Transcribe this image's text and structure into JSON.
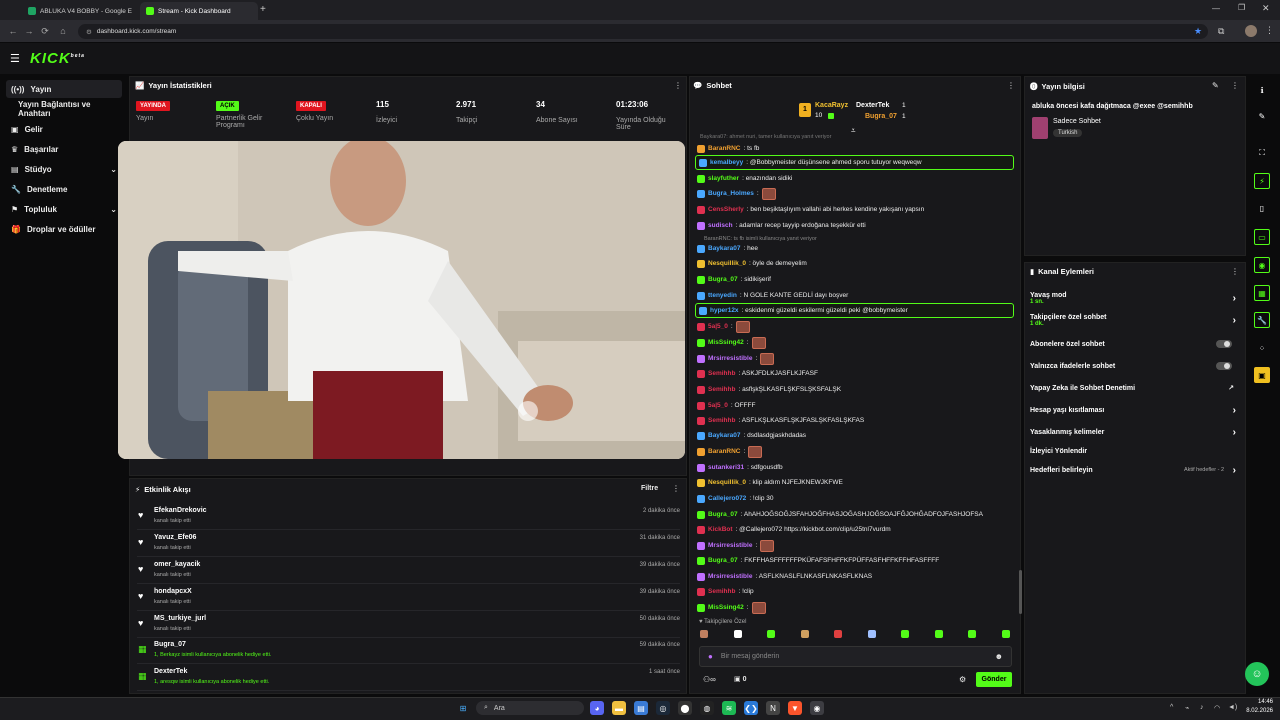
{
  "browser": {
    "tabs": [
      {
        "title": "ABLUKA V4 BOBBY - Google E"
      },
      {
        "title": "Stream - Kick Dashboard"
      }
    ],
    "url": "dashboard.kick.com/stream"
  },
  "app": {
    "logo": "KICK",
    "logo_sup": "beta"
  },
  "sidebar": {
    "items": [
      {
        "label": "Yayın"
      },
      {
        "label": "Yayın Bağlantısı ve Anahtarı"
      },
      {
        "label": "Gelir"
      },
      {
        "label": "Başarılar"
      },
      {
        "label": "Stüdyo"
      },
      {
        "label": "Denetleme"
      },
      {
        "label": "Topluluk"
      },
      {
        "label": "Droplar ve ödüller"
      }
    ]
  },
  "stats": {
    "title": "Yayın İstatistikleri",
    "items": [
      {
        "value": "YAYINDA",
        "label": "Yayın"
      },
      {
        "value": "AÇIK",
        "label": "Partnerlik Gelir Programı"
      },
      {
        "value": "KAPALI",
        "label": "Çoklu Yayın"
      },
      {
        "value": "115",
        "label": "İzleyici"
      },
      {
        "value": "2.971",
        "label": "Takipçi"
      },
      {
        "value": "34",
        "label": "Abone Sayısı"
      },
      {
        "value": "01:23:06",
        "label": "Yayında Olduğu Süre"
      }
    ]
  },
  "activity": {
    "title": "Etkinlik Akışı",
    "filter": "Filtre",
    "items": [
      {
        "name": "EfekanDrekovic",
        "desc": "kanalı takip etti",
        "time": "2 dakika önce",
        "type": "follow"
      },
      {
        "name": "Yavuz_Efe06",
        "desc": "kanalı takip etti",
        "time": "31 dakika önce",
        "type": "follow"
      },
      {
        "name": "omer_kayacik",
        "desc": "kanalı takip etti",
        "time": "39 dakika önce",
        "type": "follow"
      },
      {
        "name": "hondapcxX",
        "desc": "kanalı takip etti",
        "time": "39 dakika önce",
        "type": "follow"
      },
      {
        "name": "MS_turkiye_jurl",
        "desc": "kanalı takip etti",
        "time": "50 dakika önce",
        "type": "follow"
      },
      {
        "name": "Bugra_07",
        "desc": "1, Berkayz isimli kullanıcıya abonelik hediye etti.",
        "time": "59 dakika önce",
        "type": "gift"
      },
      {
        "name": "DexterTek",
        "desc": "1, aresqw isimli kullanıcıya abonelik hediye etti.",
        "time": "1 saat önce",
        "type": "gift"
      }
    ]
  },
  "chat": {
    "title": "Sohbet",
    "leaderboard": [
      {
        "name": "KacaRayz",
        "count": "10"
      },
      {
        "name": "DexterTek",
        "count": "1"
      },
      {
        "name": "Bugra_07",
        "count": "1"
      }
    ],
    "reply_note_top": "Baykara07: ahmet nuri, tamer kullanıcıya yanıt veriyor",
    "messages": [
      {
        "user": "BaranRNC",
        "text": ": ts fb",
        "color": "#f0a030",
        "hl": false
      },
      {
        "user": "kemalbeyy",
        "text": ": @Bobbymeister düşünsene ahmed sporu tutuyor weqweqw",
        "color": "#4aa8ff",
        "hl": true
      },
      {
        "user": "slayfuther",
        "text": ": enazından sidiki",
        "color": "#53fc18",
        "hl": false
      },
      {
        "user": "Bugra_Holmes",
        "text": ":",
        "color": "#4aa8ff",
        "hl": false
      },
      {
        "user": "CensSherly",
        "text": ": ben beşiktaşlıyım vallahi abi herkes kendine yakışanı yapsın",
        "color": "#e03050",
        "hl": false
      },
      {
        "user": "sudisch",
        "text": ": adamlar recep tayyip erdoğana teşekkür etti",
        "color": "#c070ff",
        "hl": false
      },
      {
        "user": "Baykara07",
        "text": ": hee",
        "color": "#4aa8ff",
        "hl": false
      },
      {
        "user": "Nesquillik_0",
        "text": ": öyle de demeyelim",
        "color": "#f0c030",
        "hl": false
      },
      {
        "user": "Bugra_07",
        "text": ": sidikişerif",
        "color": "#53fc18",
        "hl": false
      },
      {
        "user": "ttenyedin",
        "text": ": N GOLE KANTE GEDLİ dayı boşver",
        "color": "#4aa8ff",
        "hl": false
      },
      {
        "user": "hyper12x",
        "text": ": eskidenmi güzeldi eskilermi güzeldi peki @bobbymeister",
        "color": "#4aa8ff",
        "hl": true
      },
      {
        "user": "5a|5_0",
        "text": ":",
        "color": "#e03050",
        "hl": false
      },
      {
        "user": "MisSsing42",
        "text": ":",
        "color": "#53fc18",
        "hl": false
      },
      {
        "user": "Mrsirresistible",
        "text": ":",
        "color": "#c070ff",
        "hl": false
      },
      {
        "user": "Semihhb",
        "text": ": ASKJFDLKJASFLKJFASF",
        "color": "#e03050",
        "hl": false
      },
      {
        "user": "Semihhb",
        "text": ": asflşkŞLKASFLŞKFSLŞKSFALŞK",
        "color": "#e03050",
        "hl": false
      },
      {
        "user": "5a|5_0",
        "text": ": OFFFF",
        "color": "#e03050",
        "hl": false
      },
      {
        "user": "Semihhb",
        "text": ": ASFLKŞLKASFLŞKJFASLŞKFASLŞKFAS",
        "color": "#e03050",
        "hl": false
      },
      {
        "user": "Baykara07",
        "text": ": dsdlasdgjaskhdadas",
        "color": "#4aa8ff",
        "hl": false
      },
      {
        "user": "BaranRNC",
        "text": ":",
        "color": "#f0a030",
        "hl": false
      },
      {
        "user": "sutankeri31",
        "text": ": sdfgousdfb",
        "color": "#c070ff",
        "hl": false
      },
      {
        "user": "Nesquillik_0",
        "text": ": klip aldım NJFEJKNEWJKFWE",
        "color": "#f0c030",
        "hl": false
      },
      {
        "user": "Callejero072",
        "text": ": !clip 30",
        "color": "#4aa8ff",
        "hl": false
      },
      {
        "user": "Bugra_07",
        "text": ": AhAHJOĞSOĞJSFAHJOĞFHASJOĞASHJOĞSOAJFĞJOHĞADFOJFASHJOFSA",
        "color": "#53fc18",
        "hl": false
      },
      {
        "user": "KickBot",
        "text": ": @Callejero072 https://kickbot.com/clip/u25tnl7vurdm",
        "color": "#e03050",
        "hl": false
      },
      {
        "user": "Mrsirresistible",
        "text": ":",
        "color": "#c070ff",
        "hl": false
      },
      {
        "user": "Bugra_07",
        "text": ": FKFFHASFFFFFFPKÜFAFSFHFFKFPÜFFASFHFFKFFHFASFFFF",
        "color": "#53fc18",
        "hl": false
      },
      {
        "user": "Mrsirresistible",
        "text": ": ASFLKNASLFLNKASFLNKASFLKNAS",
        "color": "#c070ff",
        "hl": false
      },
      {
        "user": "Semihhb",
        "text": ": !clip",
        "color": "#e03050",
        "hl": false
      },
      {
        "user": "MisSsing42",
        "text": ":",
        "color": "#53fc18",
        "hl": false
      }
    ],
    "reply_note": "BaranRNC: ts fb isimli kullanıcıya yanıt veriyor",
    "followers_only": "Takipçilere Özel",
    "input_placeholder": "Bir mesaj gönderin",
    "points": "0",
    "send": "Gönder"
  },
  "stream_info": {
    "title": "Yayın bilgisi",
    "stream_title": "abluka öncesi kafa dağıtmaca @exee @semihhb",
    "category": "Sadece Sohbet",
    "tag": "Turkish"
  },
  "channel_actions": {
    "title": "Kanal Eylemleri",
    "items": [
      {
        "label": "Yavaş mod",
        "sub": "1 sn.",
        "control": "chevron"
      },
      {
        "label": "Takipçilere özel sohbet",
        "sub": "1 dk.",
        "control": "chevron"
      },
      {
        "label": "Abonelere özel sohbet",
        "sub": "",
        "control": "toggle"
      },
      {
        "label": "Yalnızca ifadelerle sohbet",
        "sub": "",
        "control": "toggle"
      },
      {
        "label": "Yapay Zeka ile Sohbet Denetimi",
        "sub": "",
        "control": "external"
      },
      {
        "label": "Hesap yaşı kısıtlaması",
        "sub": "",
        "control": "chevron"
      },
      {
        "label": "Yasaklanmış kelimeler",
        "sub": "",
        "control": "chevron"
      },
      {
        "label": "İzleyici Yönlendir",
        "sub": "",
        "control": "none"
      },
      {
        "label": "Hedefleri belirleyin",
        "sub": "",
        "control": "chevron",
        "extra": "Aktif hedefler - 2"
      }
    ]
  },
  "taskbar": {
    "search": "Ara",
    "time": "14:46",
    "date": "8.02.2026"
  },
  "colors": {
    "accent": "#53fc18",
    "live": "#e0151f"
  }
}
